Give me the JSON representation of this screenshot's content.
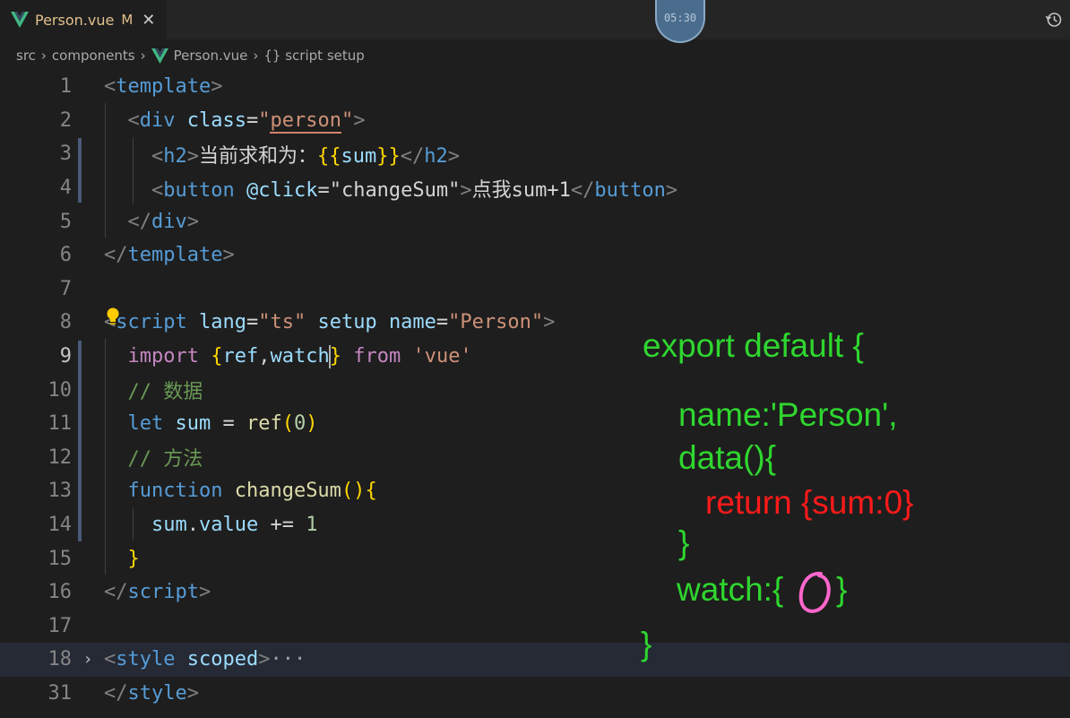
{
  "tab": {
    "file_name": "Person.vue",
    "status": "M",
    "close": "✕"
  },
  "timer": "05:30",
  "breadcrumb": {
    "src": "src",
    "components": "components",
    "file": "Person.vue",
    "symbol": "{} script setup"
  },
  "lines": {
    "1": "1",
    "2": "2",
    "3": "3",
    "4": "4",
    "5": "5",
    "6": "6",
    "7": "7",
    "8": "8",
    "9": "9",
    "10": "10",
    "11": "11",
    "12": "12",
    "13": "13",
    "14": "14",
    "15": "15",
    "16": "16",
    "17": "17",
    "18": "18",
    "31": "31"
  },
  "code": {
    "l1": {
      "tag": "template"
    },
    "l2": {
      "tag": "div",
      "attr": "class",
      "eq": "=",
      "q1": "\"",
      "val": "person",
      "q2": "\""
    },
    "l3": {
      "tag": "h2",
      "text": "当前求和为：",
      "ob": "{{",
      "var": "sum",
      "cb": "}}",
      "ctag": "h2"
    },
    "l4": {
      "tag": "button",
      "attr": "@click",
      "eq": "=",
      "val": "\"changeSum\"",
      "text": "点我sum+1",
      "ctag": "button"
    },
    "l5": {
      "ctag": "div"
    },
    "l6": {
      "ctag": "template"
    },
    "l8": {
      "tag": "script",
      "a1": "lang",
      "v1": "\"ts\"",
      "a2": "setup",
      "a3": "name",
      "v3": "\"Person\""
    },
    "l9": {
      "kw": "import",
      "ob": "{",
      "v1": "ref",
      "comma": ",",
      "v2": "watch",
      "cb": "}",
      "from": "from",
      "mod": "'vue'"
    },
    "l10": {
      "comment": "// 数据"
    },
    "l11": {
      "kw": "let",
      "var": "sum",
      "eq": " = ",
      "fn": "ref",
      "op": "(",
      "num": "0",
      "cp": ")"
    },
    "l12": {
      "comment": "// 方法"
    },
    "l13": {
      "kw": "function",
      "fn": "changeSum",
      "parens": "()",
      "ob": "{"
    },
    "l14": {
      "obj": "sum",
      "dot": ".",
      "prop": "value",
      "op": " += ",
      "num": "1"
    },
    "l15": {
      "cb": "}"
    },
    "l16": {
      "ctag": "script"
    },
    "l18": {
      "fold": "›",
      "tag": "style",
      "attr": "scoped",
      "ellipsis": "···"
    },
    "l31": {
      "ctag": "style"
    }
  },
  "annotation": {
    "line1": "export default {",
    "line2": "name:'Person',",
    "line3": "data(){",
    "line4": "return {sum:0}",
    "line5": "}",
    "line6_a": "watch:{",
    "line6_b": "}",
    "line7": "}"
  },
  "colors": {
    "annotation_green": "#2fd62f",
    "annotation_red": "#ff1a1a",
    "annotation_circle": "#ff66cc"
  }
}
